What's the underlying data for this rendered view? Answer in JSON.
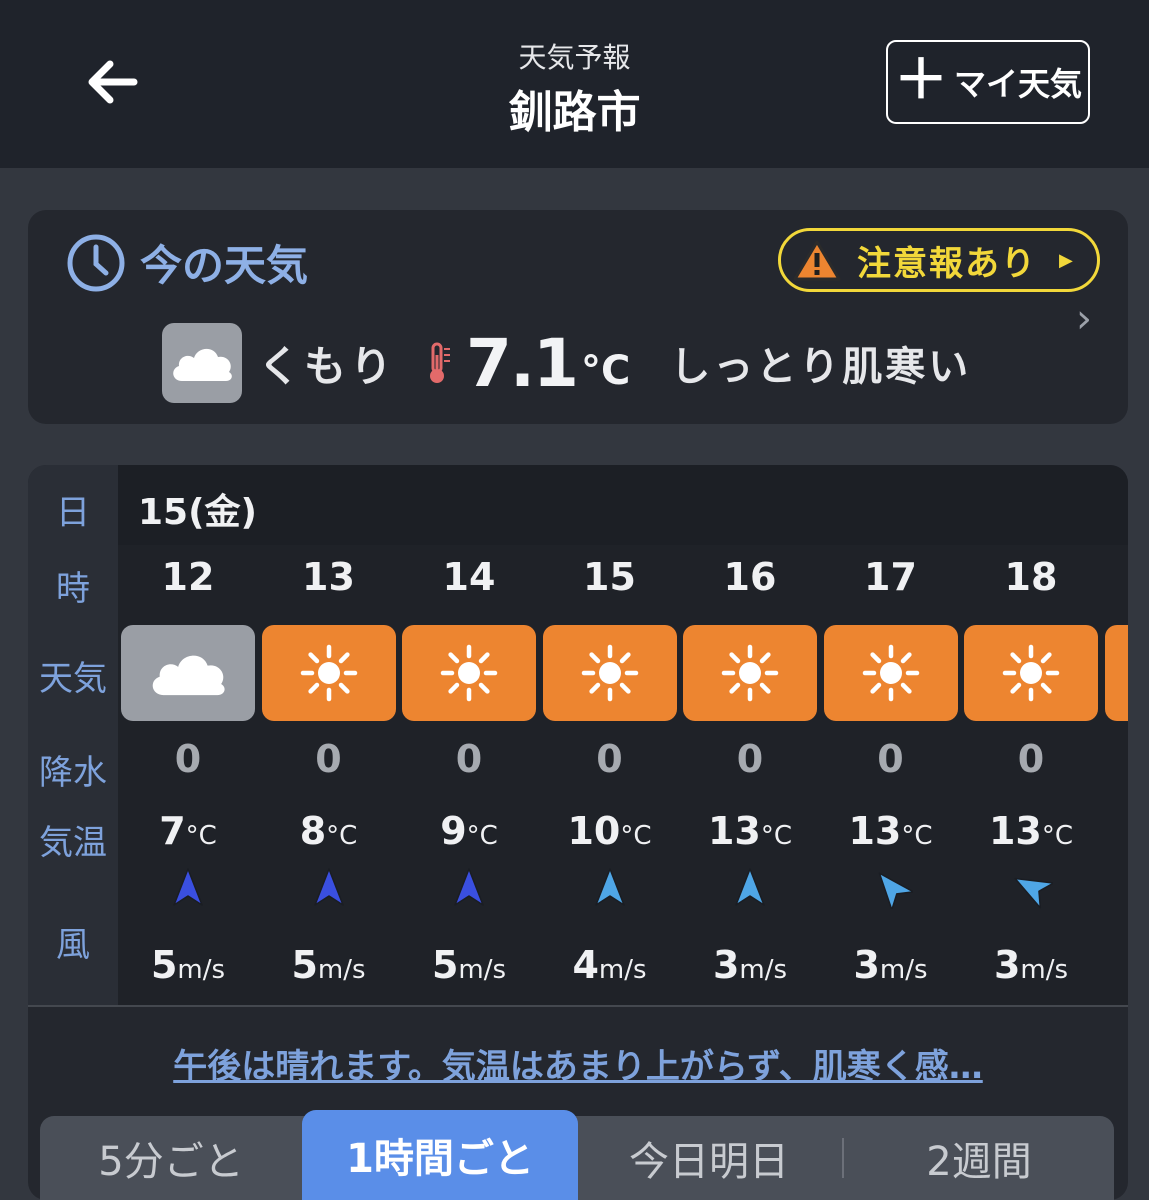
{
  "header": {
    "subtitle": "天気予報",
    "title": "釧路市",
    "my_weather_label": "マイ天気"
  },
  "now": {
    "title": "今の天気",
    "alert": "注意報あり",
    "condition": "くもり",
    "temp_value": "7.1",
    "temp_unit": "°C",
    "feel": "しっとり肌寒い"
  },
  "table": {
    "labels": {
      "day": "日",
      "hour": "時",
      "weather": "天気",
      "precip": "降水",
      "temp": "気温",
      "wind": "風"
    },
    "date": "15(金)",
    "temp_unit": "°C",
    "wind_unit": "m/s",
    "hours": [
      {
        "hour": "12",
        "weather": "cloud",
        "precip": "0",
        "temp": "7",
        "wind_speed": "5",
        "wind_dir": "north",
        "wind_color": "#3a4fe0"
      },
      {
        "hour": "13",
        "weather": "sun",
        "precip": "0",
        "temp": "8",
        "wind_speed": "5",
        "wind_dir": "north",
        "wind_color": "#3a4fe0"
      },
      {
        "hour": "14",
        "weather": "sun",
        "precip": "0",
        "temp": "9",
        "wind_speed": "5",
        "wind_dir": "north",
        "wind_color": "#3a4fe0"
      },
      {
        "hour": "15",
        "weather": "sun",
        "precip": "0",
        "temp": "10",
        "wind_speed": "4",
        "wind_dir": "north",
        "wind_color": "#4fa6e6"
      },
      {
        "hour": "16",
        "weather": "sun",
        "precip": "0",
        "temp": "13",
        "wind_speed": "3",
        "wind_dir": "north",
        "wind_color": "#4fa6e6"
      },
      {
        "hour": "17",
        "weather": "sun",
        "precip": "0",
        "temp": "13",
        "wind_speed": "3",
        "wind_dir": "north-west",
        "wind_color": "#4fa6e6"
      },
      {
        "hour": "18",
        "weather": "sun",
        "precip": "0",
        "temp": "13",
        "wind_speed": "3",
        "wind_dir": "west-north-west",
        "wind_color": "#4fa6e6"
      }
    ],
    "summary": "午後は晴れます。気温はあまり上がらず、肌寒く感…"
  },
  "tabs": [
    {
      "label": "5分ごと",
      "active": false
    },
    {
      "label": "1時間ごと",
      "active": true
    },
    {
      "label": "今日明日",
      "active": false
    },
    {
      "label": "2週間",
      "active": false
    }
  ],
  "colors": {
    "accent_blue": "#7ea2dc",
    "alert_yellow": "#f2d83a",
    "sun_orange": "#ed8530",
    "cloud_gray": "#9a9ea5",
    "tab_active": "#5a8ee8"
  }
}
